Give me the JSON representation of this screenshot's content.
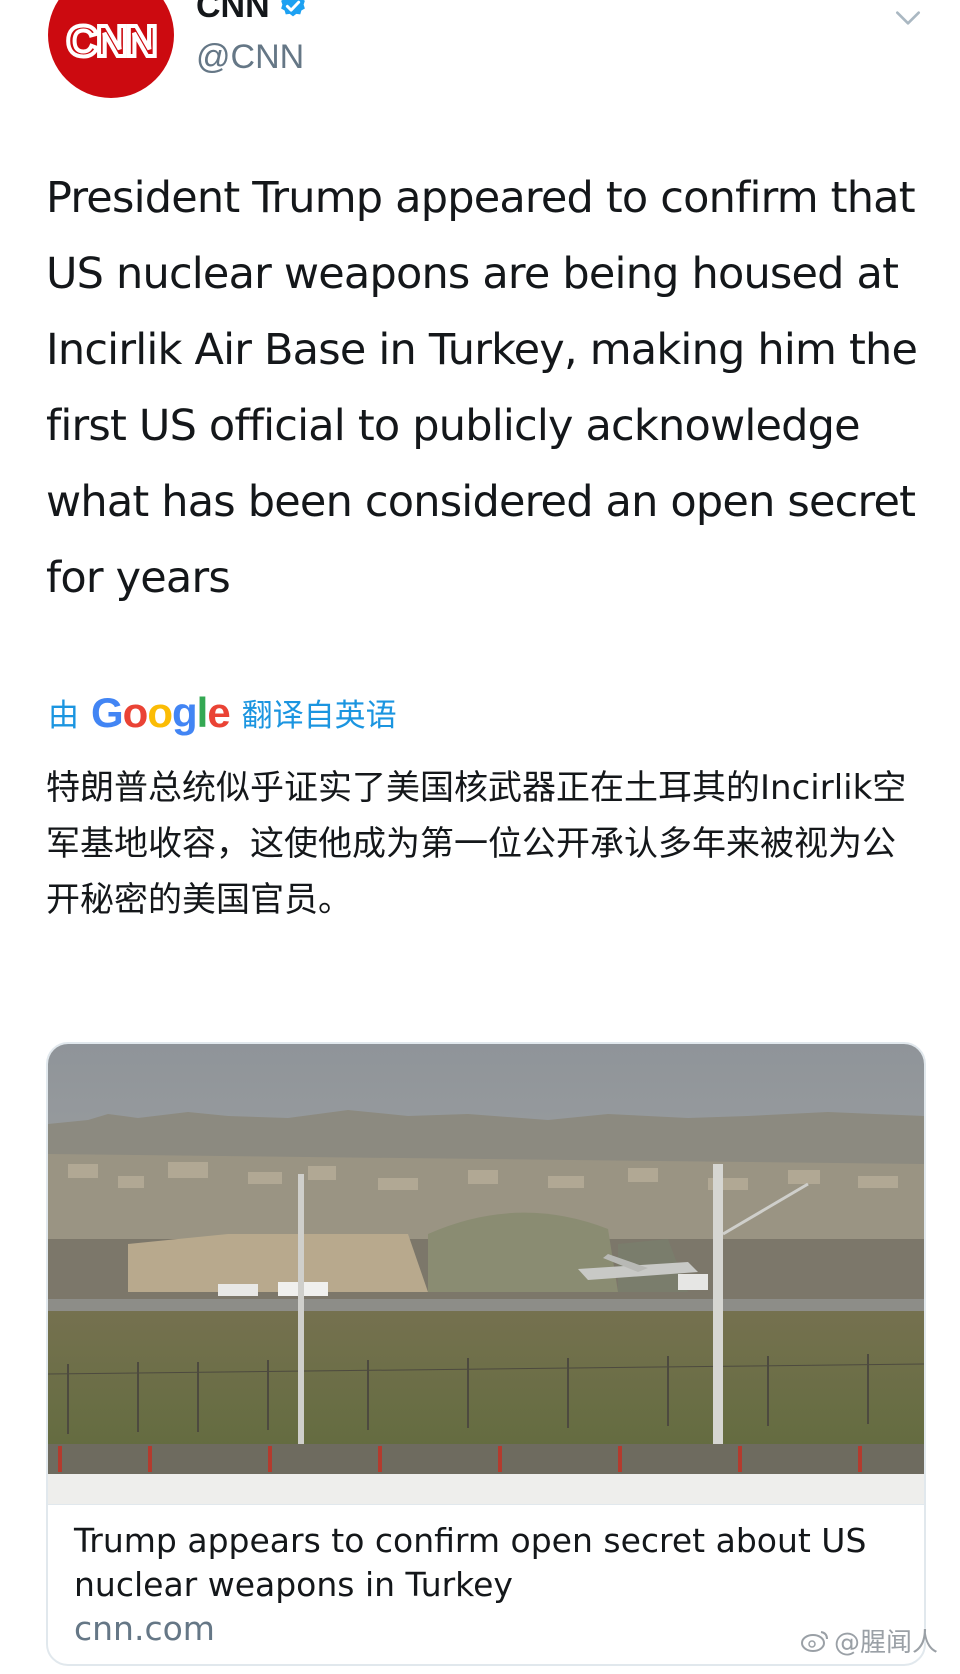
{
  "author": {
    "display_name": "CNN",
    "handle": "@CNN",
    "avatar_text": "CNN",
    "verified": true,
    "brand_color": "#cc0a10"
  },
  "tweet": {
    "text": "President Trump appeared to confirm that US nuclear weapons are being housed at Incirlik Air Base in Turkey, making him the first US official to publicly acknowledge what has been considered an open secret for years"
  },
  "translation": {
    "prefix": "由",
    "provider": "Google",
    "suffix": "翻译自英语",
    "text": "特朗普总统似乎证实了美国核武器正在土耳其的Incirlik空军基地收容，这使他成为第一位公开承认多年来被视为公开秘密的美国官员。",
    "accent_color": "#1b95e0"
  },
  "card": {
    "title": "Trump appears to confirm open secret about US nuclear weapons in Turkey",
    "domain": "cnn.com",
    "image_icon": "air-base-photo"
  },
  "watermark": {
    "text": "@腥闻人",
    "icon": "weibo-icon"
  },
  "icons": {
    "menu": "chevron-down-icon",
    "verified": "verified-badge-icon"
  }
}
